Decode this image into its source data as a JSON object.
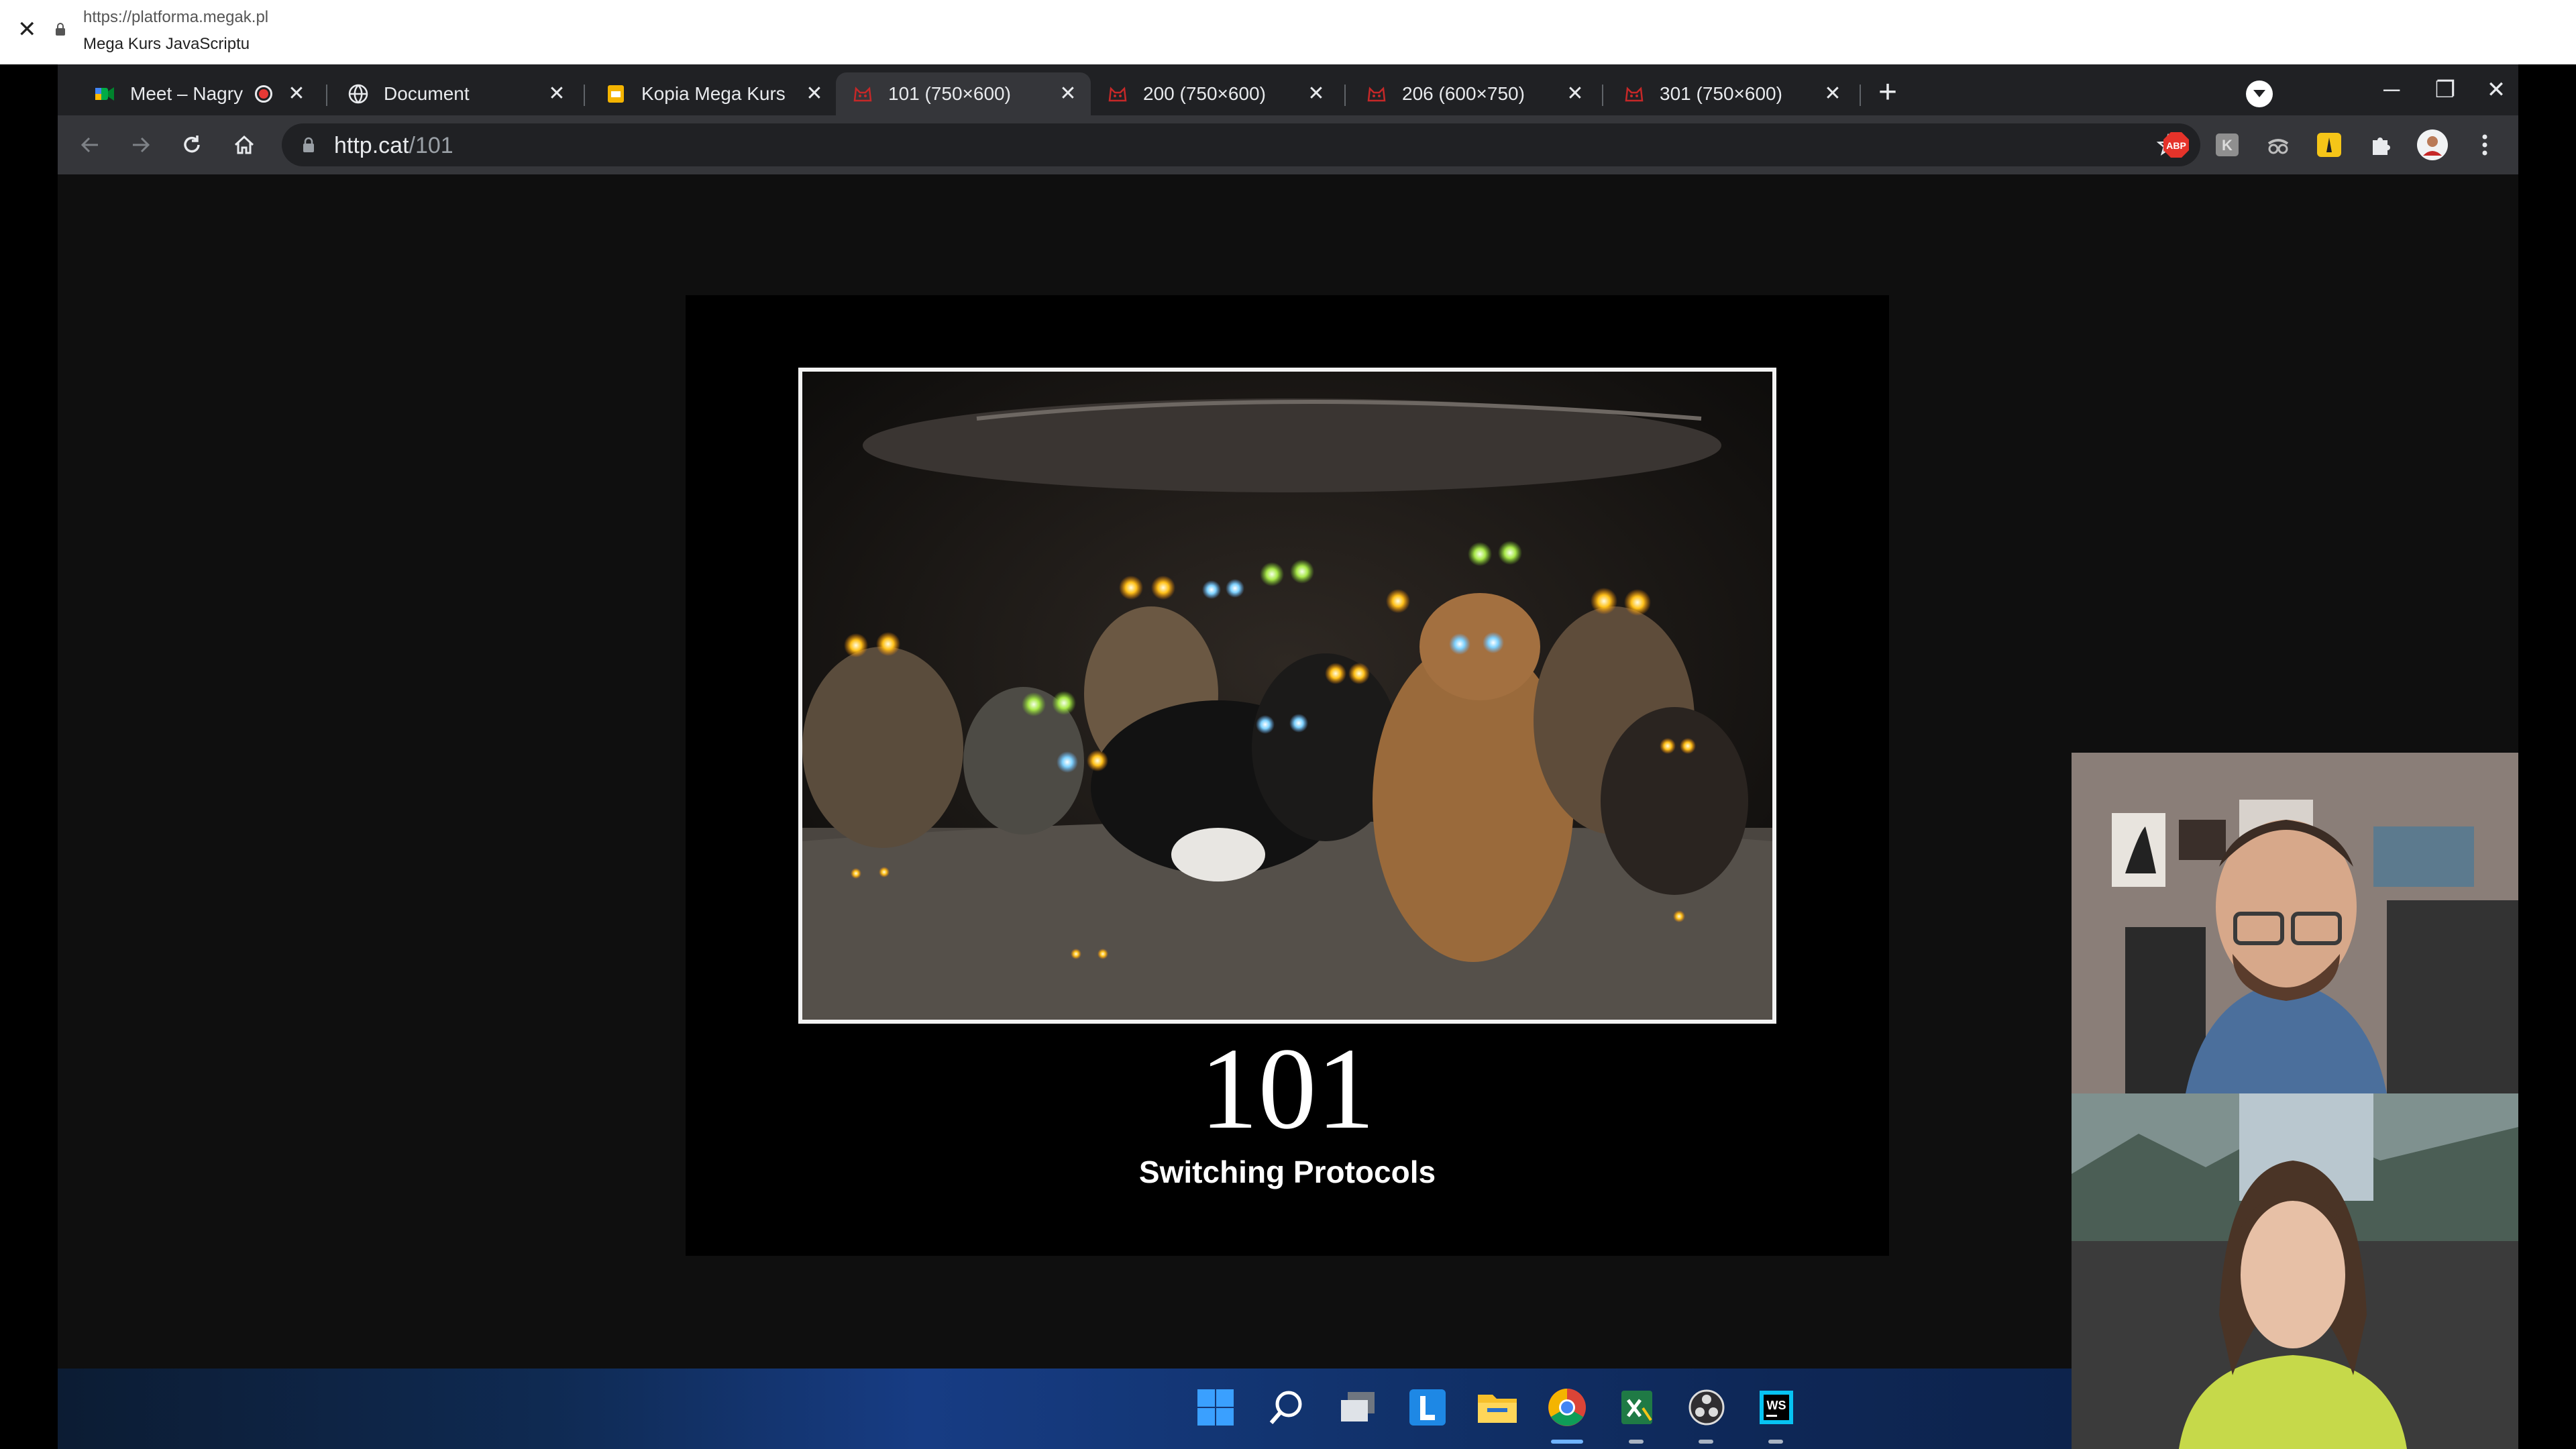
{
  "player": {
    "close_glyph": "✕",
    "url": "https://platforma.megak.pl",
    "title": "Mega Kurs JavaScriptu"
  },
  "tabs": [
    {
      "title": "Meet – Nagry",
      "close": "✕",
      "icon": "google-meet-icon",
      "recording": true
    },
    {
      "title": "Document",
      "close": "✕",
      "icon": "globe-icon"
    },
    {
      "title": "Kopia Mega Kurs",
      "close": "✕",
      "icon": "google-slides-icon"
    },
    {
      "title": "101 (750×600)",
      "close": "✕",
      "icon": "http-cat-icon",
      "active": true
    },
    {
      "title": "200 (750×600)",
      "close": "✕",
      "icon": "http-cat-icon"
    },
    {
      "title": "206 (600×750)",
      "close": "✕",
      "icon": "http-cat-icon"
    },
    {
      "title": "301 (750×600)",
      "close": "✕",
      "icon": "http-cat-icon"
    }
  ],
  "tabstrip": {
    "new_tab": "+",
    "minimize": "─",
    "restore": "❐",
    "close": "✕"
  },
  "omnibox": {
    "host": "http.cat",
    "path": "/101"
  },
  "extensions": [
    {
      "name": "adblock-plus-icon",
      "label": "ABP",
      "color": "#e5332a"
    },
    {
      "name": "extension-k-icon",
      "label": "K",
      "color": "#9e9e9e"
    },
    {
      "name": "extension-spy-icon",
      "label": "",
      "color": "#bdbdbd"
    },
    {
      "name": "extension-yellow-icon",
      "label": "",
      "color": "#f5c518"
    }
  ],
  "poster": {
    "code": "101",
    "phrase": "Switching Protocols"
  },
  "taskbar": {
    "icons": [
      "windows-start-icon",
      "search-icon",
      "task-view-icon",
      "l-app-icon",
      "file-explorer-icon",
      "chrome-icon",
      "excel-icon",
      "obs-icon",
      "webstorm-icon"
    ]
  },
  "colors": {
    "tab_bg": "#202124",
    "toolbar_bg": "#35363a",
    "accent_red": "#e53935"
  }
}
